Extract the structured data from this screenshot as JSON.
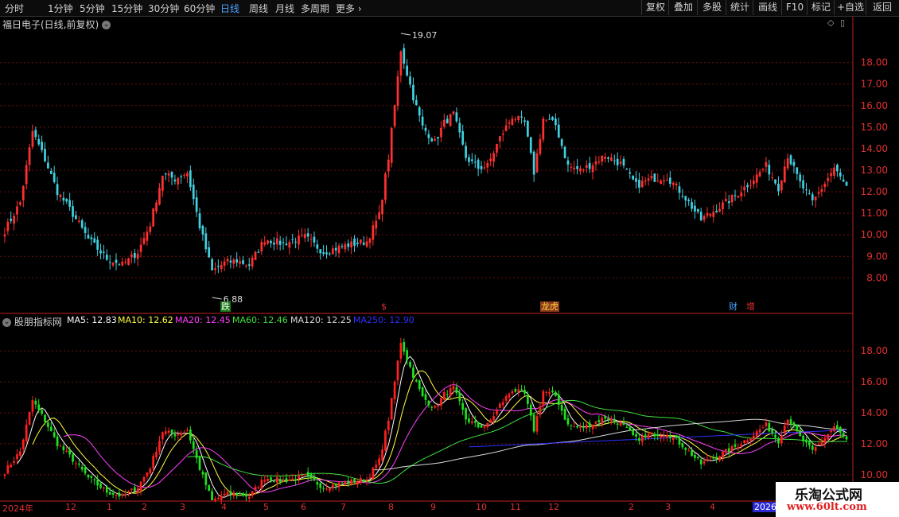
{
  "toolbar": {
    "periods": [
      "分时",
      "1分钟",
      "5分钟",
      "15分钟",
      "30分钟",
      "60分钟",
      "日线",
      "周线",
      "月线",
      "多周期",
      "更多"
    ],
    "active_period": "日线",
    "buttons": [
      "复权",
      "叠加",
      "多股",
      "统计",
      "画线",
      "F10",
      "标记",
      "+自选",
      "返回"
    ]
  },
  "main_title": "福日电子(日线,前复权)",
  "indicator": {
    "name": "股朋指标网",
    "ma_labels": [
      {
        "text": "MA5: 12.83",
        "color": "#ffffff"
      },
      {
        "text": "MA10: 12.62",
        "color": "#ffff40"
      },
      {
        "text": "MA20: 12.45",
        "color": "#ff40ff"
      },
      {
        "text": "MA60: 12.46",
        "color": "#40e040"
      },
      {
        "text": "MA120: 12.25",
        "color": "#d8d8d8"
      },
      {
        "text": "MA250: 12.90",
        "color": "#3030ff"
      }
    ]
  },
  "annotations": {
    "high_label": "19.07",
    "low_label": "6.88",
    "badges": [
      {
        "text": "跌",
        "bg": "#1a7a1a",
        "color": "#ffffff"
      },
      {
        "text": "$",
        "bg": "#000000",
        "color": "#e03030"
      },
      {
        "text": "龙虎",
        "bg": "#8a3a1a",
        "color": "#ffd040"
      },
      {
        "text": "财",
        "bg": "#000000",
        "color": "#4aa3ff"
      },
      {
        "text": "增",
        "bg": "#000000",
        "color": "#e03030"
      }
    ]
  },
  "watermark": {
    "line1": "乐淘公式网",
    "line2": "www.60lt.com"
  },
  "chart_data": [
    {
      "type": "candlestick",
      "title": "福日电子(日线,前复权)",
      "y_ticks": [
        8.0,
        9.0,
        10.0,
        11.0,
        12.0,
        13.0,
        14.0,
        15.0,
        16.0,
        17.0,
        18.0
      ],
      "ylim": [
        6.5,
        19.5
      ],
      "x_labels": [
        "2024年",
        "12",
        "1",
        "2",
        "3",
        "4",
        "5",
        "6",
        "7",
        "8",
        "9",
        "10",
        "11",
        "12",
        "2026/",
        "2",
        "3",
        "4"
      ],
      "price_path": [
        {
          "t": 0,
          "v": 10.2
        },
        {
          "t": 5,
          "v": 11.5
        },
        {
          "t": 9,
          "v": 14.8
        },
        {
          "t": 13,
          "v": 13.5
        },
        {
          "t": 17,
          "v": 12.0
        },
        {
          "t": 21,
          "v": 11.2
        },
        {
          "t": 27,
          "v": 9.8
        },
        {
          "t": 33,
          "v": 8.9
        },
        {
          "t": 38,
          "v": 8.6
        },
        {
          "t": 43,
          "v": 9.2
        },
        {
          "t": 47,
          "v": 10.5
        },
        {
          "t": 51,
          "v": 12.8
        },
        {
          "t": 55,
          "v": 12.6
        },
        {
          "t": 59,
          "v": 12.9
        },
        {
          "t": 63,
          "v": 10.4
        },
        {
          "t": 67,
          "v": 8.3
        },
        {
          "t": 71,
          "v": 8.7
        },
        {
          "t": 75,
          "v": 8.8
        },
        {
          "t": 79,
          "v": 8.6
        },
        {
          "t": 84,
          "v": 9.8
        },
        {
          "t": 90,
          "v": 9.6
        },
        {
          "t": 97,
          "v": 9.9
        },
        {
          "t": 103,
          "v": 9.2
        },
        {
          "t": 110,
          "v": 9.5
        },
        {
          "t": 117,
          "v": 9.7
        },
        {
          "t": 121,
          "v": 10.9
        },
        {
          "t": 124,
          "v": 13.6
        },
        {
          "t": 126,
          "v": 16.0
        },
        {
          "t": 128,
          "v": 18.6
        },
        {
          "t": 130,
          "v": 17.5
        },
        {
          "t": 132,
          "v": 16.4
        },
        {
          "t": 135,
          "v": 15.0
        },
        {
          "t": 139,
          "v": 14.3
        },
        {
          "t": 142,
          "v": 15.2
        },
        {
          "t": 145,
          "v": 15.6
        },
        {
          "t": 149,
          "v": 13.6
        },
        {
          "t": 153,
          "v": 13.1
        },
        {
          "t": 156,
          "v": 13.2
        },
        {
          "t": 160,
          "v": 14.5
        },
        {
          "t": 164,
          "v": 15.5
        },
        {
          "t": 168,
          "v": 15.2
        },
        {
          "t": 171,
          "v": 12.9
        },
        {
          "t": 174,
          "v": 15.4
        },
        {
          "t": 178,
          "v": 15.1
        },
        {
          "t": 182,
          "v": 13.2
        },
        {
          "t": 186,
          "v": 13.0
        },
        {
          "t": 190,
          "v": 13.3
        },
        {
          "t": 194,
          "v": 13.7
        },
        {
          "t": 199,
          "v": 13.3
        },
        {
          "t": 204,
          "v": 12.3
        },
        {
          "t": 209,
          "v": 12.6
        },
        {
          "t": 214,
          "v": 12.7
        },
        {
          "t": 219,
          "v": 11.9
        },
        {
          "t": 225,
          "v": 10.7
        },
        {
          "t": 230,
          "v": 11.2
        },
        {
          "t": 236,
          "v": 11.8
        },
        {
          "t": 242,
          "v": 12.6
        },
        {
          "t": 246,
          "v": 13.2
        },
        {
          "t": 250,
          "v": 12.2
        },
        {
          "t": 253,
          "v": 13.7
        },
        {
          "t": 257,
          "v": 12.4
        },
        {
          "t": 261,
          "v": 11.5
        },
        {
          "t": 265,
          "v": 12.4
        },
        {
          "t": 268,
          "v": 13.1
        },
        {
          "t": 272,
          "v": 12.2
        }
      ]
    },
    {
      "type": "candlestick",
      "title": "股朋指标网",
      "y_ticks": [
        10.0,
        12.0,
        14.0,
        16.0,
        18.0
      ],
      "ylim": [
        8.5,
        19.5
      ],
      "series": [
        {
          "name": "MA5",
          "last": 12.83
        },
        {
          "name": "MA10",
          "last": 12.62
        },
        {
          "name": "MA20",
          "last": 12.45
        },
        {
          "name": "MA60",
          "last": 12.46
        },
        {
          "name": "MA120",
          "last": 12.25
        },
        {
          "name": "MA250",
          "last": 12.9
        }
      ]
    }
  ]
}
